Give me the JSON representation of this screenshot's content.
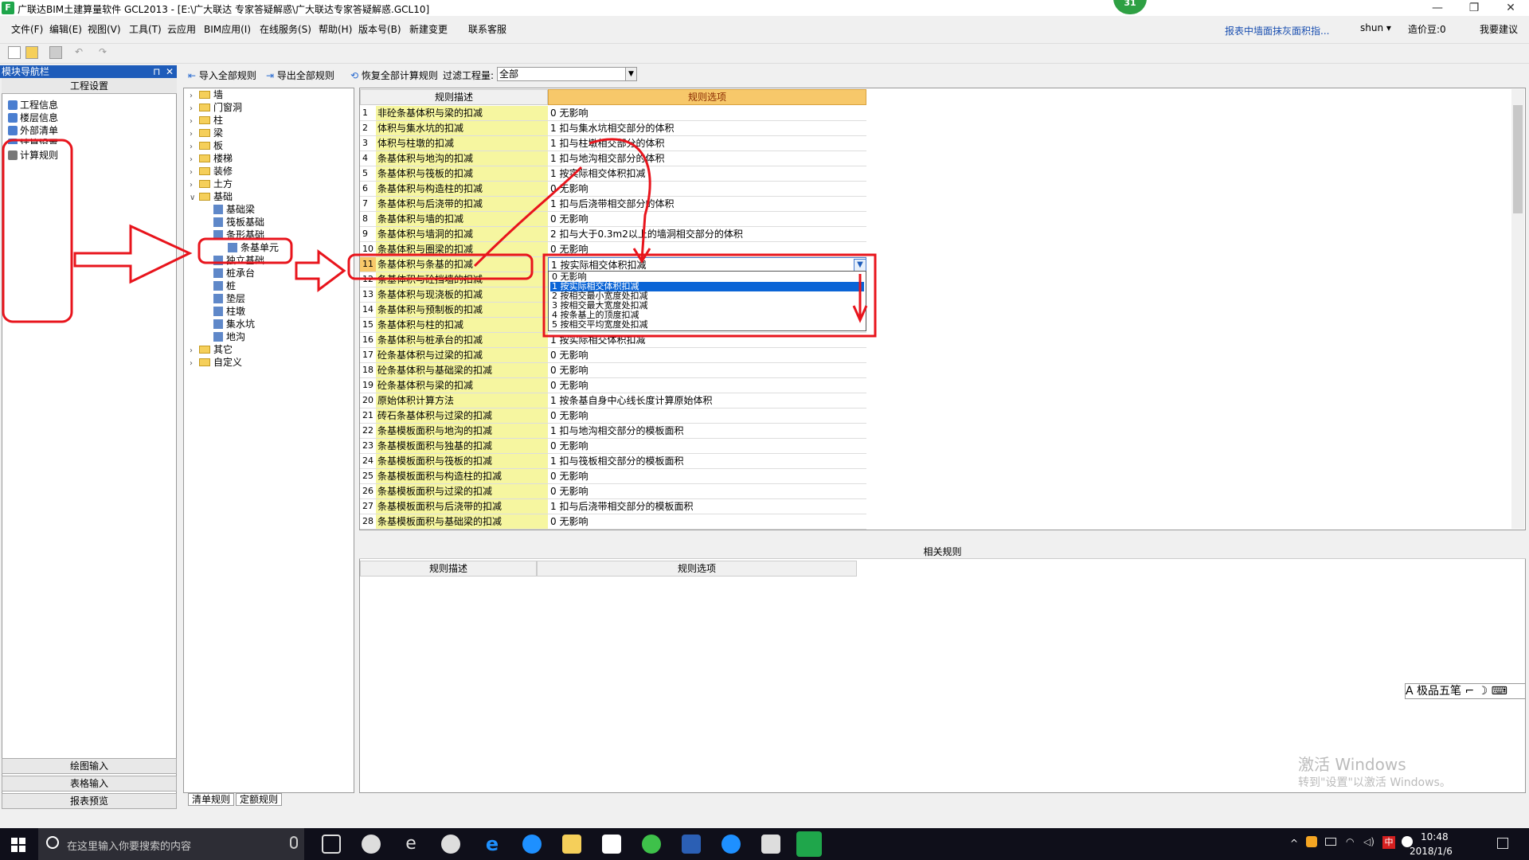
{
  "window": {
    "icon_letter": "F",
    "title": "广联达BIM土建算量软件 GCL2013 - [E:\\广大联达    专家答疑解惑\\广大联达专家答疑解惑.GCL10]",
    "badge": "31",
    "controls": [
      "—",
      "❐",
      "✕"
    ]
  },
  "menu": {
    "items": [
      "文件(F)",
      "编辑(E)",
      "视图(V)",
      "工具(T)",
      "云应用",
      "BIM应用(I)",
      "在线服务(S)",
      "帮助(H)",
      "版本号(B)",
      "新建变更",
      "联系客服"
    ],
    "right_link": "报表中墙面抹灰面积指...",
    "user": "shun ▾",
    "price": "造价豆:0",
    "feedback": "我要建议"
  },
  "nav": {
    "header": "模块导航栏",
    "pin": "⊓",
    "close": "✕",
    "top_tab": "工程设置",
    "items": [
      "工程信息",
      "楼层信息",
      "外部清单",
      "计算设置",
      "计算规则"
    ],
    "bottom_tabs": [
      "绘图输入",
      "表格输入",
      "报表预览"
    ]
  },
  "tree_toolbar": {
    "import_all": "导入全部规则",
    "export_all": "导出全部规则",
    "restore_all": "恢复全部计算规则",
    "filter_label": "过滤工程量:",
    "filter_value": "全部"
  },
  "tree": {
    "nodes": [
      {
        "label": "墙",
        "level": 0
      },
      {
        "label": "门窗洞",
        "level": 0
      },
      {
        "label": "柱",
        "level": 0
      },
      {
        "label": "梁",
        "level": 0
      },
      {
        "label": "板",
        "level": 0
      },
      {
        "label": "楼梯",
        "level": 0
      },
      {
        "label": "装修",
        "level": 0
      },
      {
        "label": "土方",
        "level": 0
      },
      {
        "label": "基础",
        "level": 0
      },
      {
        "label": "基础梁",
        "level": 1
      },
      {
        "label": "筏板基础",
        "level": 1
      },
      {
        "label": "条形基础",
        "level": 1
      },
      {
        "label": "条基单元",
        "level": 2
      },
      {
        "label": "独立基础",
        "level": 1
      },
      {
        "label": "桩承台",
        "level": 1
      },
      {
        "label": "桩",
        "level": 1
      },
      {
        "label": "垫层",
        "level": 1
      },
      {
        "label": "柱墩",
        "level": 1
      },
      {
        "label": "集水坑",
        "level": 1
      },
      {
        "label": "地沟",
        "level": 1
      },
      {
        "label": "其它",
        "level": 0
      },
      {
        "label": "自定义",
        "level": 0
      }
    ],
    "bottom_tabs": [
      "清单规则",
      "定额规则"
    ]
  },
  "grid": {
    "col_desc": "规则描述",
    "col_opt": "规则选项",
    "rows": [
      {
        "n": "1",
        "desc": "非砼条基体积与梁的扣减",
        "opt": "0  无影响"
      },
      {
        "n": "2",
        "desc": "体积与集水坑的扣减",
        "opt": "1  扣与集水坑相交部分的体积"
      },
      {
        "n": "3",
        "desc": "体积与柱墩的扣减",
        "opt": "1  扣与柱墩相交部分的体积"
      },
      {
        "n": "4",
        "desc": "条基体积与地沟的扣减",
        "opt": "1  扣与地沟相交部分的体积"
      },
      {
        "n": "5",
        "desc": "条基体积与筏板的扣减",
        "opt": "1  按实际相交体积扣减"
      },
      {
        "n": "6",
        "desc": "条基体积与构造柱的扣减",
        "opt": "0  无影响"
      },
      {
        "n": "7",
        "desc": "条基体积与后浇带的扣减",
        "opt": "1  扣与后浇带相交部分的体积"
      },
      {
        "n": "8",
        "desc": "条基体积与墙的扣减",
        "opt": "0  无影响"
      },
      {
        "n": "9",
        "desc": "条基体积与墙洞的扣减",
        "opt": "2  扣与大于0.3m2以上的墙洞相交部分的体积"
      },
      {
        "n": "10",
        "desc": "条基体积与圈梁的扣减",
        "opt": "0  无影响"
      },
      {
        "n": "11",
        "desc": "条基体积与条基的扣减",
        "opt": "1  按实际相交体积扣减"
      },
      {
        "n": "12",
        "desc": "条基体积与砼挡墙的扣减",
        "opt": ""
      },
      {
        "n": "13",
        "desc": "条基体积与现浇板的扣减",
        "opt": ""
      },
      {
        "n": "14",
        "desc": "条基体积与预制板的扣减",
        "opt": ""
      },
      {
        "n": "15",
        "desc": "条基体积与柱的扣减",
        "opt": ""
      },
      {
        "n": "16",
        "desc": "条基体积与桩承台的扣减",
        "opt": "1  按实际相交体积扣减"
      },
      {
        "n": "17",
        "desc": "砼条基体积与过梁的扣减",
        "opt": "0  无影响"
      },
      {
        "n": "18",
        "desc": "砼条基体积与基础梁的扣减",
        "opt": "0  无影响"
      },
      {
        "n": "19",
        "desc": "砼条基体积与梁的扣减",
        "opt": "0  无影响"
      },
      {
        "n": "20",
        "desc": "原始体积计算方法",
        "opt": "1 按条基自身中心线长度计算原始体积"
      },
      {
        "n": "21",
        "desc": "砖石条基体积与过梁的扣减",
        "opt": "0  无影响"
      },
      {
        "n": "22",
        "desc": "条基模板面积与地沟的扣减",
        "opt": "1  扣与地沟相交部分的模板面积"
      },
      {
        "n": "23",
        "desc": "条基模板面积与独基的扣减",
        "opt": "0  无影响"
      },
      {
        "n": "24",
        "desc": "条基模板面积与筏板的扣减",
        "opt": "1  扣与筏板相交部分的模板面积"
      },
      {
        "n": "25",
        "desc": "条基模板面积与构造柱的扣减",
        "opt": "0  无影响"
      },
      {
        "n": "26",
        "desc": "条基模板面积与过梁的扣减",
        "opt": "0  无影响"
      },
      {
        "n": "27",
        "desc": "条基模板面积与后浇带的扣减",
        "opt": "1  扣与后浇带相交部分的模板面积"
      },
      {
        "n": "28",
        "desc": "条基模板面积与基础梁的扣减",
        "opt": "0  无影响"
      }
    ],
    "dropdown": {
      "options": [
        "0  无影响",
        "1  按实际相交体积扣减",
        "2  按相交最小宽度处扣减",
        "3  按相交最大宽度处扣减",
        "4  按条基上的顶度扣减",
        "5  按相交平均宽度处扣减"
      ],
      "selected_index": 1
    }
  },
  "related": {
    "title": "相关规则",
    "col_desc": "规则描述",
    "col_opt": "规则选项"
  },
  "ime": {
    "label": "A 极品五笔 ⌐ ☽ ⌨"
  },
  "watermark": {
    "line1": "激活 Windows",
    "line2": "转到\"设置\"以激活 Windows。"
  },
  "taskbar": {
    "search_placeholder": "在这里输入你要搜索的内容",
    "time": "10:48",
    "date": "2018/1/6",
    "ime_tray": "中"
  },
  "colors": {
    "annotation_red": "#e8141c",
    "nav_header_blue": "#1e5cba",
    "rule_option_header": "#f7c86a",
    "desc_cell_yellow": "#f6f6a0"
  }
}
